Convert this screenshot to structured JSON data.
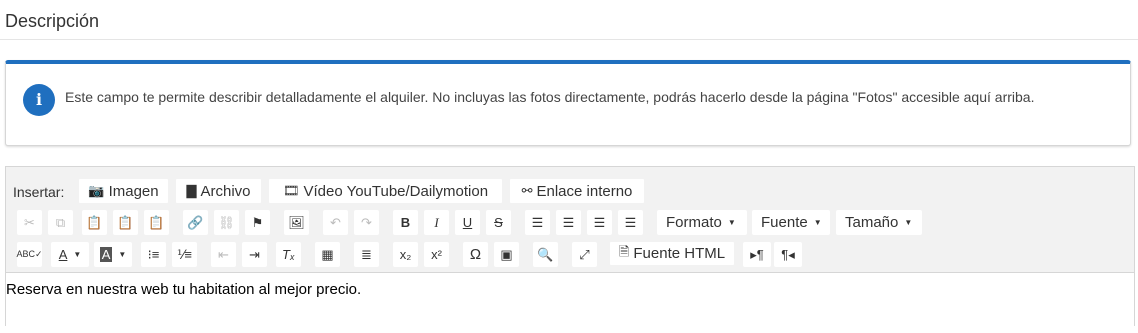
{
  "header": {
    "title": "Descripción"
  },
  "notice": {
    "icon": "info-icon",
    "text": "Este campo te permite describir detalladamente el alquiler. No incluyas las fotos directamente, podrás hacerlo desde la página \"Fotos\" accesible aquí arriba.",
    "accent_color": "#1f6fbf"
  },
  "editor": {
    "insert_label": "Insertar:",
    "insert_buttons": [
      {
        "label": "Imagen",
        "icon": "camera-icon"
      },
      {
        "label": "Archivo",
        "icon": "file-icon"
      },
      {
        "label": "Vídeo YouTube/Dailymotion",
        "icon": "film-icon"
      },
      {
        "label": "Enlace interno",
        "icon": "link-icon"
      }
    ],
    "dropdowns": {
      "format": "Formato",
      "font": "Fuente",
      "size": "Tamaño"
    },
    "source_label": "Fuente HTML",
    "content": "Reserva en nuestra web tu habitation al mejor precio."
  }
}
